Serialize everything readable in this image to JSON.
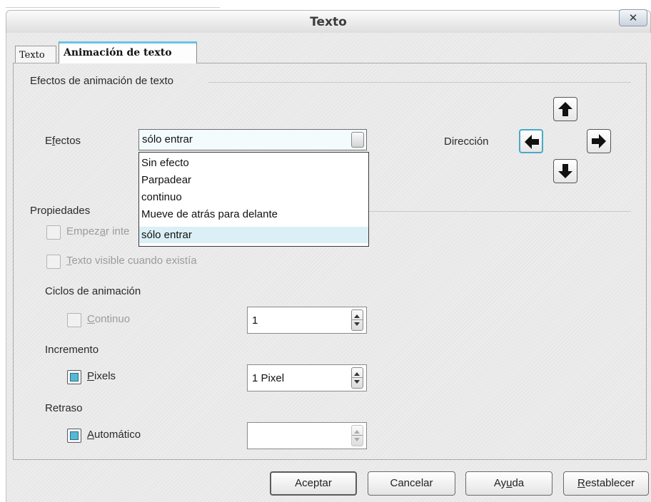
{
  "window": {
    "title": "Texto",
    "close_label": "✕"
  },
  "tabs": [
    {
      "label": "Texto",
      "active": false
    },
    {
      "label": "Animación de texto",
      "active": true
    }
  ],
  "effects_section": {
    "title": "Efectos de animación de texto",
    "effects_label_pre": "E",
    "effects_label_ul": "f",
    "effects_label_post": "ectos",
    "effects_value": "sólo entrar",
    "effects_options": [
      "Sin efecto",
      "Parpadear",
      "continuo",
      "Mueve de atrás para delante",
      "sólo entrar"
    ],
    "selected_option": "sólo entrar",
    "direction_label": "Dirección",
    "direction_buttons": [
      "arrow-up-icon",
      "arrow-left-icon",
      "arrow-right-icon",
      "arrow-down-icon"
    ],
    "active_direction": "left"
  },
  "properties_section": {
    "title": "Propiedades",
    "start_inside": {
      "pre": "Empez",
      "ul": "a",
      "post": "r inte",
      "checked": false,
      "enabled": false
    },
    "visible_text": {
      "ul": "T",
      "post": "exto visible cuando existía",
      "checked": false,
      "enabled": false
    },
    "cycles": {
      "title": "Ciclos de animación",
      "continuous_ul": "C",
      "continuous_post": "ontinuo",
      "continuous_checked": false,
      "value": "1"
    },
    "increment": {
      "title": "Incremento",
      "pixels_ul": "P",
      "pixels_post": "ixels",
      "pixels_checked": true,
      "value": "1 Pixel"
    },
    "delay": {
      "title": "Retraso",
      "auto_ul": "A",
      "auto_post": "utomático",
      "auto_checked": true,
      "value": ""
    }
  },
  "buttons": {
    "ok": "Aceptar",
    "cancel": "Cancelar",
    "help_pre": "Ay",
    "help_ul": "u",
    "help_post": "da",
    "reset_ul": "R",
    "reset_post": "establecer"
  },
  "colors": {
    "accent": "#64c6e6",
    "selection": "#dbeff6",
    "check_fill": "#55b9d6"
  }
}
